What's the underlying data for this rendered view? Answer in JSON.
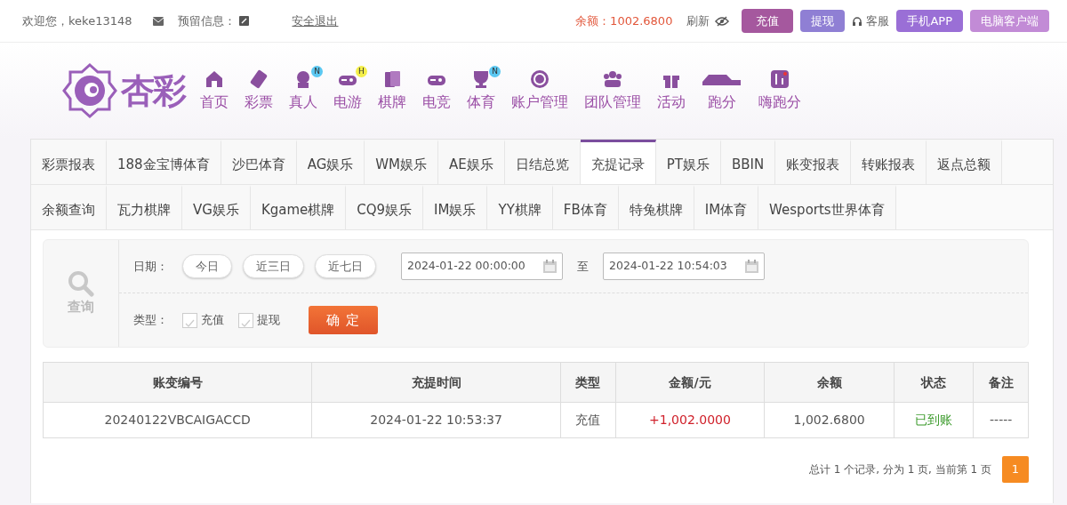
{
  "top_bar": {
    "welcome": "欢迎您，keke13148",
    "notice_label": "预留信息：",
    "logout": "安全退出",
    "balance": "余额：1002.6800",
    "refresh": "刷新",
    "actions": [
      {
        "kind": "button",
        "label": "充值",
        "color": "#a5589e"
      },
      {
        "kind": "button",
        "label": "提现",
        "color": "#8f7fd4"
      },
      {
        "kind": "link",
        "label": "客服"
      },
      {
        "kind": "button",
        "label": "手机APP",
        "color": "#9a6fd6"
      },
      {
        "kind": "button",
        "label": "电脑客户端",
        "color": "#c28bd6"
      }
    ]
  },
  "nav": {
    "logo_text": "杏彩",
    "items": [
      {
        "label": "首页"
      },
      {
        "label": "彩票"
      },
      {
        "label": "真人",
        "badge": "N"
      },
      {
        "label": "电游",
        "badge": "H"
      },
      {
        "label": "棋牌"
      },
      {
        "label": "电竞"
      },
      {
        "label": "体育",
        "badge": "N"
      },
      {
        "label": "账户管理"
      },
      {
        "label": "团队管理"
      },
      {
        "label": "活动"
      },
      {
        "label": "跑分"
      },
      {
        "label": "嗨跑分"
      }
    ]
  },
  "tab_rows": [
    [
      {
        "label": "彩票报表",
        "selected": false
      },
      {
        "label": "188金宝博体育",
        "selected": false
      },
      {
        "label": "沙巴体育",
        "selected": false
      },
      {
        "label": "AG娱乐",
        "selected": false
      },
      {
        "label": "WM娱乐",
        "selected": false
      },
      {
        "label": "AE娱乐",
        "selected": false
      },
      {
        "label": "日结总览",
        "selected": false
      },
      {
        "label": "充提记录",
        "selected": true
      },
      {
        "label": "PT娱乐",
        "selected": false
      },
      {
        "label": "BBIN",
        "selected": false
      },
      {
        "label": "账变报表",
        "selected": false
      },
      {
        "label": "转账报表",
        "selected": false
      },
      {
        "label": "返点总额",
        "selected": false
      }
    ],
    [
      {
        "label": "余额查询",
        "selected": false
      },
      {
        "label": "瓦力棋牌",
        "selected": false
      },
      {
        "label": "VG娱乐",
        "selected": false
      },
      {
        "label": "Kgame棋牌",
        "selected": false
      },
      {
        "label": "CQ9娱乐",
        "selected": false
      },
      {
        "label": "IM娱乐",
        "selected": false
      },
      {
        "label": "YY棋牌",
        "selected": false
      },
      {
        "label": "FB体育",
        "selected": false
      },
      {
        "label": "特兔棋牌",
        "selected": false
      },
      {
        "label": "IM体育",
        "selected": false
      },
      {
        "label": "Wesports世界体育",
        "selected": false
      }
    ]
  ],
  "filter": {
    "search_label": "查询",
    "date_label": "日期：",
    "quick_ranges": [
      "今日",
      "近三日",
      "近七日"
    ],
    "start": "2024-01-22 00:00:00",
    "to": "至",
    "end": "2024-01-22 10:54:03",
    "type_label": "类型：",
    "types": [
      {
        "label": "充值",
        "checked": false
      },
      {
        "label": "提现",
        "checked": false
      }
    ],
    "confirm": "确 定"
  },
  "table": {
    "columns": [
      "账变编号",
      "充提时间",
      "类型",
      "金额/元",
      "余额",
      "状态",
      "备注"
    ],
    "rows": [
      {
        "cells": [
          "20240122VBCAIGACCD",
          "2024-01-22 10:53:37",
          "充值",
          "+1,002.0000",
          "1,002.6800",
          "已到账",
          "-----"
        ]
      }
    ]
  },
  "pagination": {
    "summary": "总计 1 个记录, 分为 1 页, 当前第 1 页",
    "pages": [
      {
        "label": "1",
        "selected": true
      }
    ]
  }
}
